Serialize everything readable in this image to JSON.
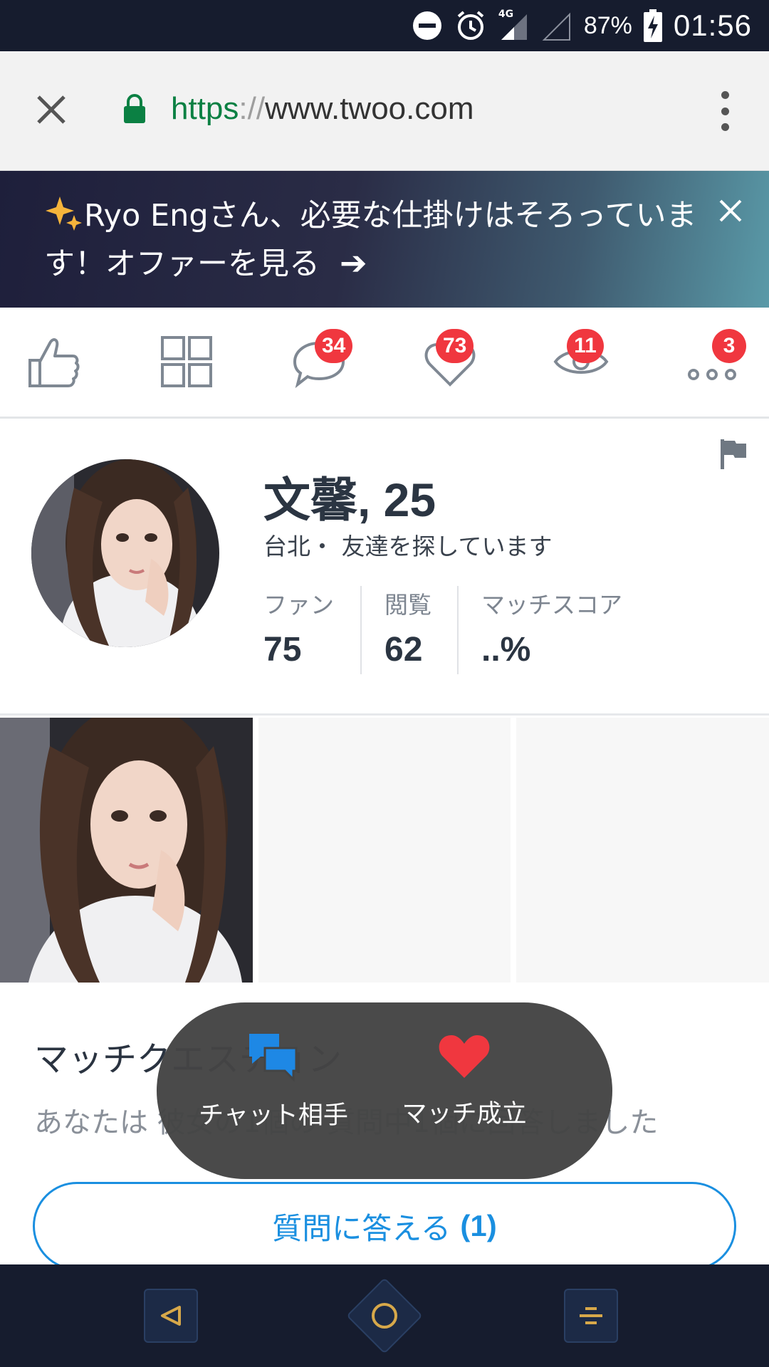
{
  "status_bar": {
    "battery_text": "87%",
    "time": "01:56",
    "network": "4G",
    "icons": [
      "do-not-disturb-icon",
      "alarm-icon",
      "signal-icon",
      "signal-empty-icon",
      "battery-charging-icon"
    ]
  },
  "browser": {
    "url_scheme": "https",
    "url_separator": "://",
    "url_host": "www.twoo.com"
  },
  "promo": {
    "text": "Ryo Engさん、必要な仕掛けはそろっています！オファーを見る",
    "arrow": "➔"
  },
  "nav": {
    "items": [
      {
        "icon": "thumbs-up-icon"
      },
      {
        "icon": "grid-icon"
      },
      {
        "icon": "chat-icon",
        "badge": "34"
      },
      {
        "icon": "heart-icon",
        "badge": "73"
      },
      {
        "icon": "eye-icon",
        "badge": "11"
      },
      {
        "icon": "more-icon",
        "badge": "3"
      }
    ]
  },
  "profile": {
    "name_age": "文馨, 25",
    "subtitle": "台北・ 友達を探しています",
    "stats": [
      {
        "label": "ファン",
        "value": "75"
      },
      {
        "label": "閲覧",
        "value": "62"
      },
      {
        "label": "マッチスコア",
        "value": "..%"
      }
    ]
  },
  "match_question": {
    "title": "マッチクエスチョン",
    "description": "あなたは 彼女の1個の 質問中1個に回答しました",
    "button_label": "質問に答える",
    "button_count": "(1)"
  },
  "overlay": {
    "chat_label": "チャット相手",
    "match_label": "マッチ成立"
  },
  "colors": {
    "accent_blue": "#1a8fe0",
    "badge_red": "#f0373f",
    "heart_red": "#f0373f",
    "status_bar_bg": "#161c2e"
  }
}
